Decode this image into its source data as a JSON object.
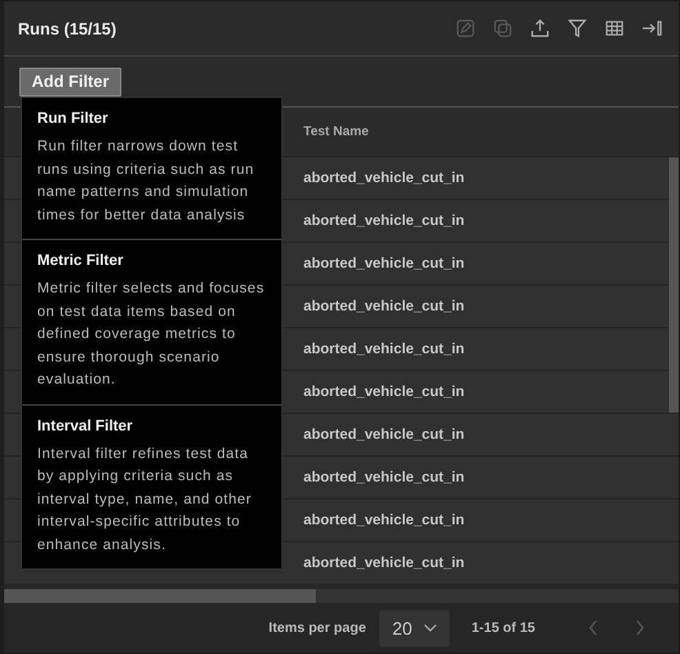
{
  "panel": {
    "title": "Runs (15/15)"
  },
  "toolbar": [
    {
      "kind": "edit"
    },
    {
      "kind": "copy"
    },
    {
      "kind": "upload"
    },
    {
      "kind": "filter"
    },
    {
      "kind": "table"
    },
    {
      "kind": "collapse"
    }
  ],
  "add_filter": {
    "label": "Add Filter"
  },
  "filter_menu": [
    {
      "title": "Run Filter",
      "description": "Run filter narrows down test runs using criteria such as run name patterns and simulation times for better data analysis"
    },
    {
      "title": "Metric Filter",
      "description": "Metric filter selects and focuses on test data items based on defined coverage metrics to ensure thorough scenario evaluation."
    },
    {
      "title": "Interval Filter",
      "description": "Interval filter refines test data by applying criteria such as interval type, name, and other interval-specific attributes to enhance analysis."
    }
  ],
  "table": {
    "columns": [
      "Test Name"
    ],
    "rows": [
      "aborted_vehicle_cut_in",
      "aborted_vehicle_cut_in",
      "aborted_vehicle_cut_in",
      "aborted_vehicle_cut_in",
      "aborted_vehicle_cut_in",
      "aborted_vehicle_cut_in",
      "aborted_vehicle_cut_in",
      "aborted_vehicle_cut_in",
      "aborted_vehicle_cut_in",
      "aborted_vehicle_cut_in"
    ]
  },
  "pagination": {
    "items_per_page_label": "Items per page",
    "page_size": "20",
    "range": "1-15 of 15"
  }
}
